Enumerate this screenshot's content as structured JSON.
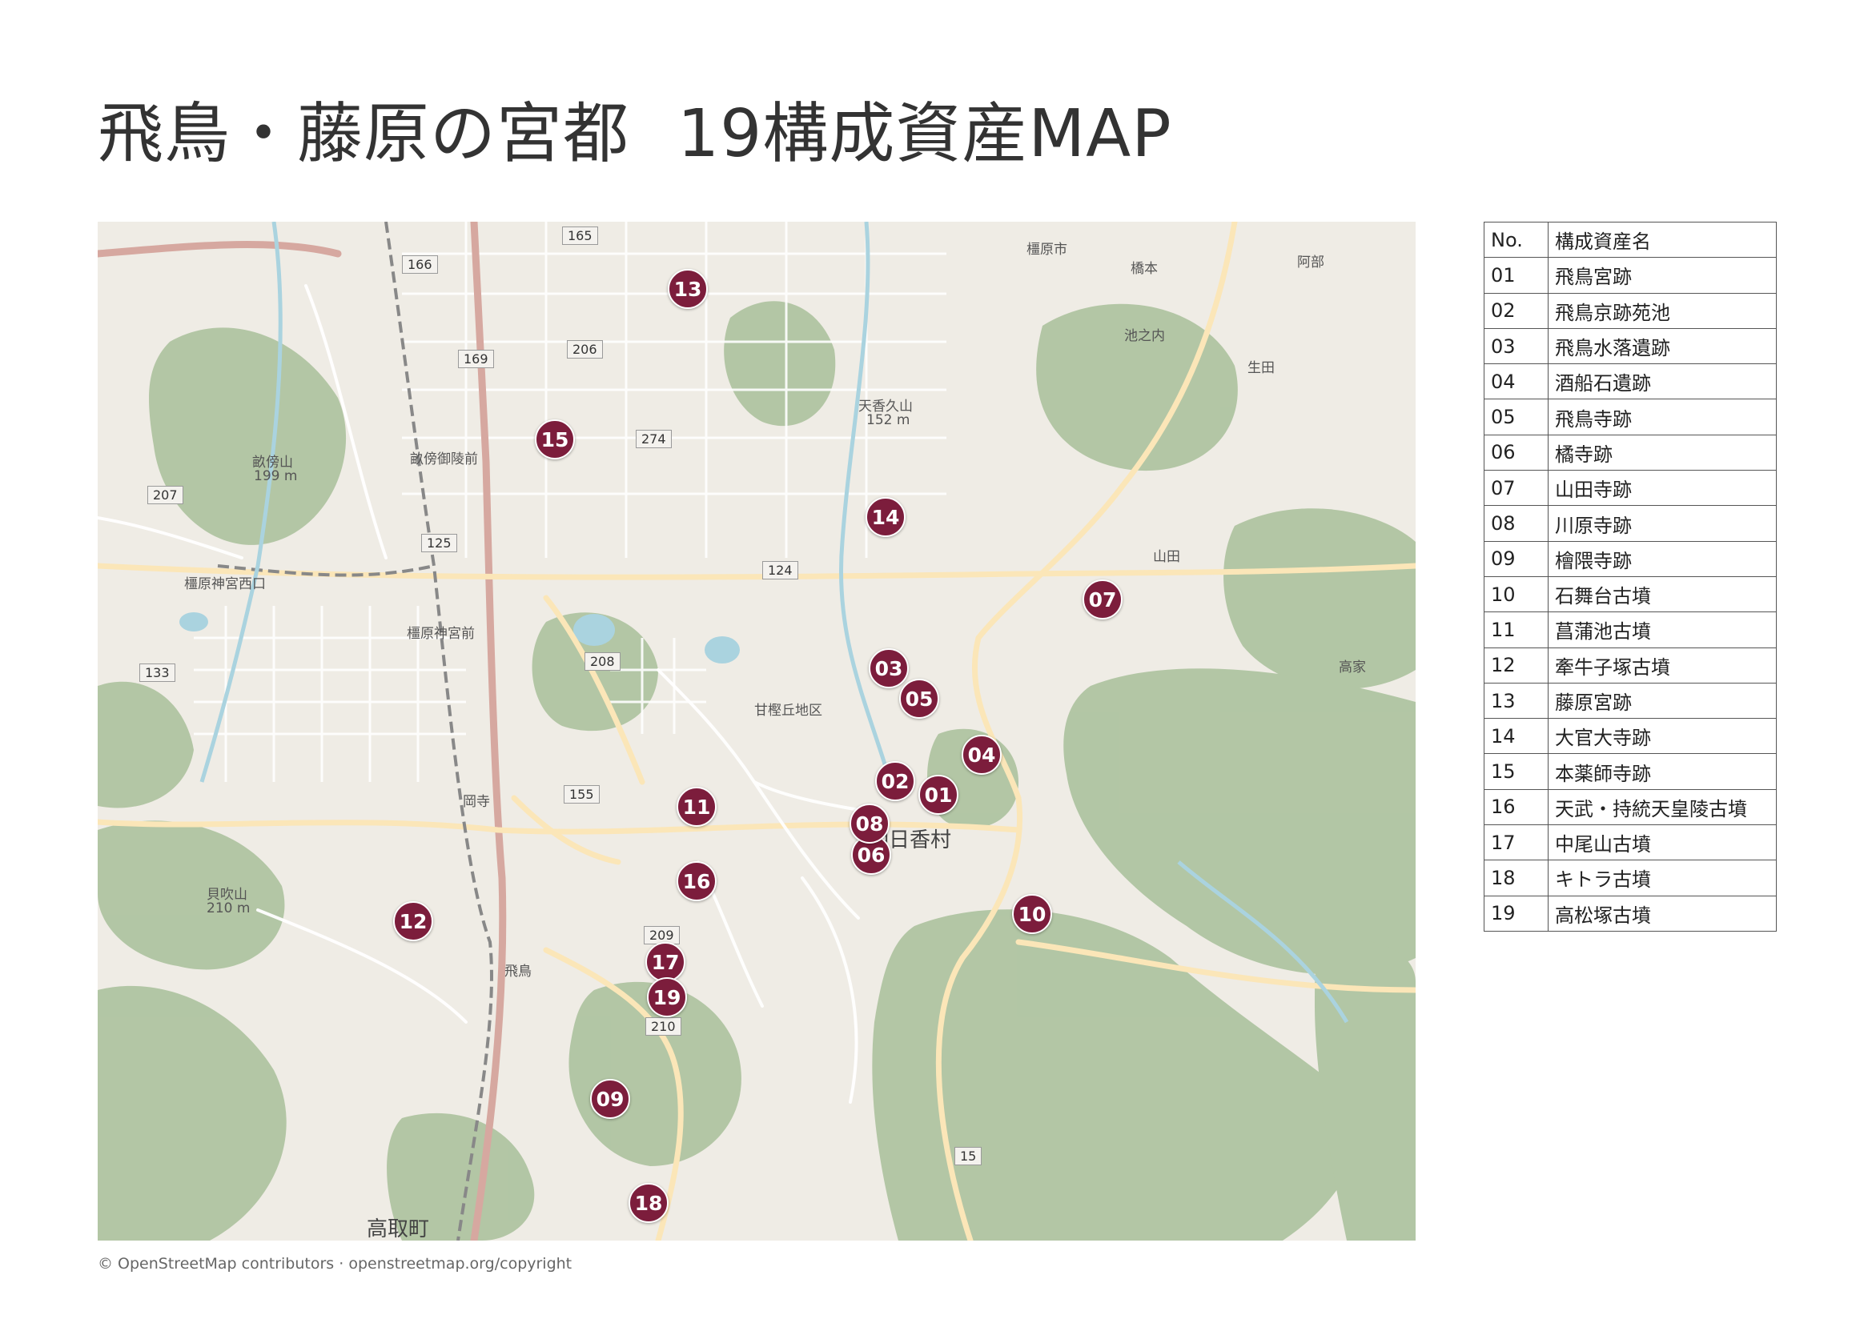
{
  "title": {
    "main": "飛鳥・藤原の宮都",
    "sub": "19構成資産MAP"
  },
  "attribution": "© OpenStreetMap contributors · openstreetmap.org/copyright",
  "colors": {
    "marker": "#7c1d3c",
    "marker_text": "#ffffff",
    "map_land": "#efece5",
    "map_forest": "#a8c09a",
    "map_water": "#aad3df"
  },
  "map": {
    "markers": [
      "01",
      "02",
      "03",
      "04",
      "05",
      "06",
      "07",
      "08",
      "09",
      "10",
      "11",
      "12",
      "13",
      "14",
      "15",
      "16",
      "17",
      "18",
      "19"
    ],
    "labels": {
      "asuka_village": "明日香村",
      "takatori": "高取町",
      "asuka": "飛鳥",
      "kashihara": "橿原市",
      "amanokaguyama": "天香久山",
      "amanokaguyama_elev": "152 m",
      "unebiyama": "畝傍山",
      "unebiyama_elev": "199 m",
      "hashimoto": "橋本",
      "ikenouchi": "池之内",
      "yamada": "山田",
      "ikuta": "生田",
      "abe": "阿部",
      "takaie": "高家",
      "amakashi": "甘樫丘地区",
      "kashiharajingu_mae": "橿原神宮前",
      "kashiharajingu_nishi": "橿原神宮西口",
      "okadera": "岡寺",
      "kaibukiyama": "貝吹山",
      "kaibukiyama_elev": "210 m",
      "unebigoryo_mae": "畝傍御陵前"
    },
    "road_shields": [
      "165",
      "166",
      "169",
      "206",
      "274",
      "207",
      "125",
      "124",
      "208",
      "133",
      "155",
      "209",
      "210",
      "15"
    ]
  },
  "legend": {
    "header": {
      "no": "No.",
      "name": "構成資産名"
    },
    "rows": [
      {
        "no": "01",
        "name": "飛鳥宮跡"
      },
      {
        "no": "02",
        "name": "飛鳥京跡苑池"
      },
      {
        "no": "03",
        "name": "飛鳥水落遺跡"
      },
      {
        "no": "04",
        "name": "酒船石遺跡"
      },
      {
        "no": "05",
        "name": "飛鳥寺跡"
      },
      {
        "no": "06",
        "name": "橘寺跡"
      },
      {
        "no": "07",
        "name": "山田寺跡"
      },
      {
        "no": "08",
        "name": "川原寺跡"
      },
      {
        "no": "09",
        "name": "檜隈寺跡"
      },
      {
        "no": "10",
        "name": "石舞台古墳"
      },
      {
        "no": "11",
        "name": "菖蒲池古墳"
      },
      {
        "no": "12",
        "name": "牽牛子塚古墳"
      },
      {
        "no": "13",
        "name": "藤原宮跡"
      },
      {
        "no": "14",
        "name": "大官大寺跡"
      },
      {
        "no": "15",
        "name": "本薬師寺跡"
      },
      {
        "no": "16",
        "name": "天武・持統天皇陵古墳"
      },
      {
        "no": "17",
        "name": "中尾山古墳"
      },
      {
        "no": "18",
        "name": "キトラ古墳"
      },
      {
        "no": "19",
        "name": "高松塚古墳"
      }
    ]
  }
}
